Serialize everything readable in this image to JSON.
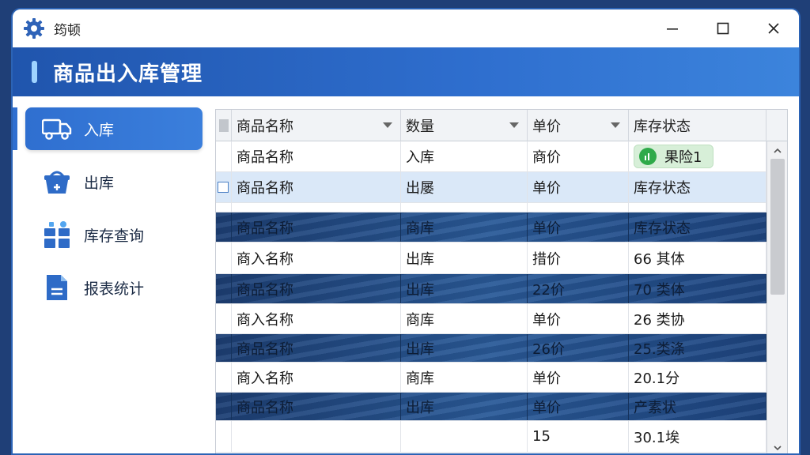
{
  "window": {
    "title": "筠顿"
  },
  "header": {
    "title": "商品出入库管理"
  },
  "sidebar": {
    "items": [
      {
        "label": "入库",
        "icon": "truck-icon",
        "active": true
      },
      {
        "label": "出库",
        "icon": "basket-icon",
        "active": false
      },
      {
        "label": "库存查询",
        "icon": "inventory-icon",
        "active": false
      },
      {
        "label": "报表统计",
        "icon": "report-icon",
        "active": false
      }
    ]
  },
  "table": {
    "columns": [
      "商品名称",
      "数量",
      "单价",
      "库存状态"
    ],
    "rows": [
      {
        "style": "light",
        "cells": [
          "商品名称",
          "入库",
          "商价",
          "果险1"
        ],
        "status_pill": true
      },
      {
        "style": "selected",
        "cells": [
          "商品名称",
          "出屡",
          "单价",
          "库存状态"
        ],
        "checkbox": true
      },
      {
        "style": "light",
        "cells": [
          "",
          "",
          "",
          ""
        ]
      },
      {
        "style": "dark",
        "cells": [
          "商品名称",
          "商库",
          "单价",
          "库存状态"
        ]
      },
      {
        "style": "light",
        "cells": [
          "商入名称",
          "出库",
          "措价",
          "66 其体"
        ]
      },
      {
        "style": "dark",
        "cells": [
          "商品名称",
          "出库",
          "22价",
          "70 类体"
        ]
      },
      {
        "style": "light",
        "cells": [
          "商入名称",
          "商库",
          "单价",
          "26 类协"
        ]
      },
      {
        "style": "dark",
        "cells": [
          "商品名称",
          "出库",
          "26价",
          "25.类涤"
        ]
      },
      {
        "style": "light",
        "cells": [
          "商入名称",
          "商库",
          "单价",
          "20.1分"
        ]
      },
      {
        "style": "dark",
        "cells": [
          "商品名称",
          "出库",
          "单价",
          "产素状"
        ]
      },
      {
        "style": "light",
        "cells": [
          "",
          "",
          "15",
          "30.1埃"
        ]
      }
    ]
  },
  "colors": {
    "accent": "#2f6fd0",
    "header_start": "#2055ad",
    "header_end": "#3c84dc",
    "status_green": "#2eaa49",
    "selected_row": "#dae8f8",
    "dark_row": "#1d3f74"
  }
}
